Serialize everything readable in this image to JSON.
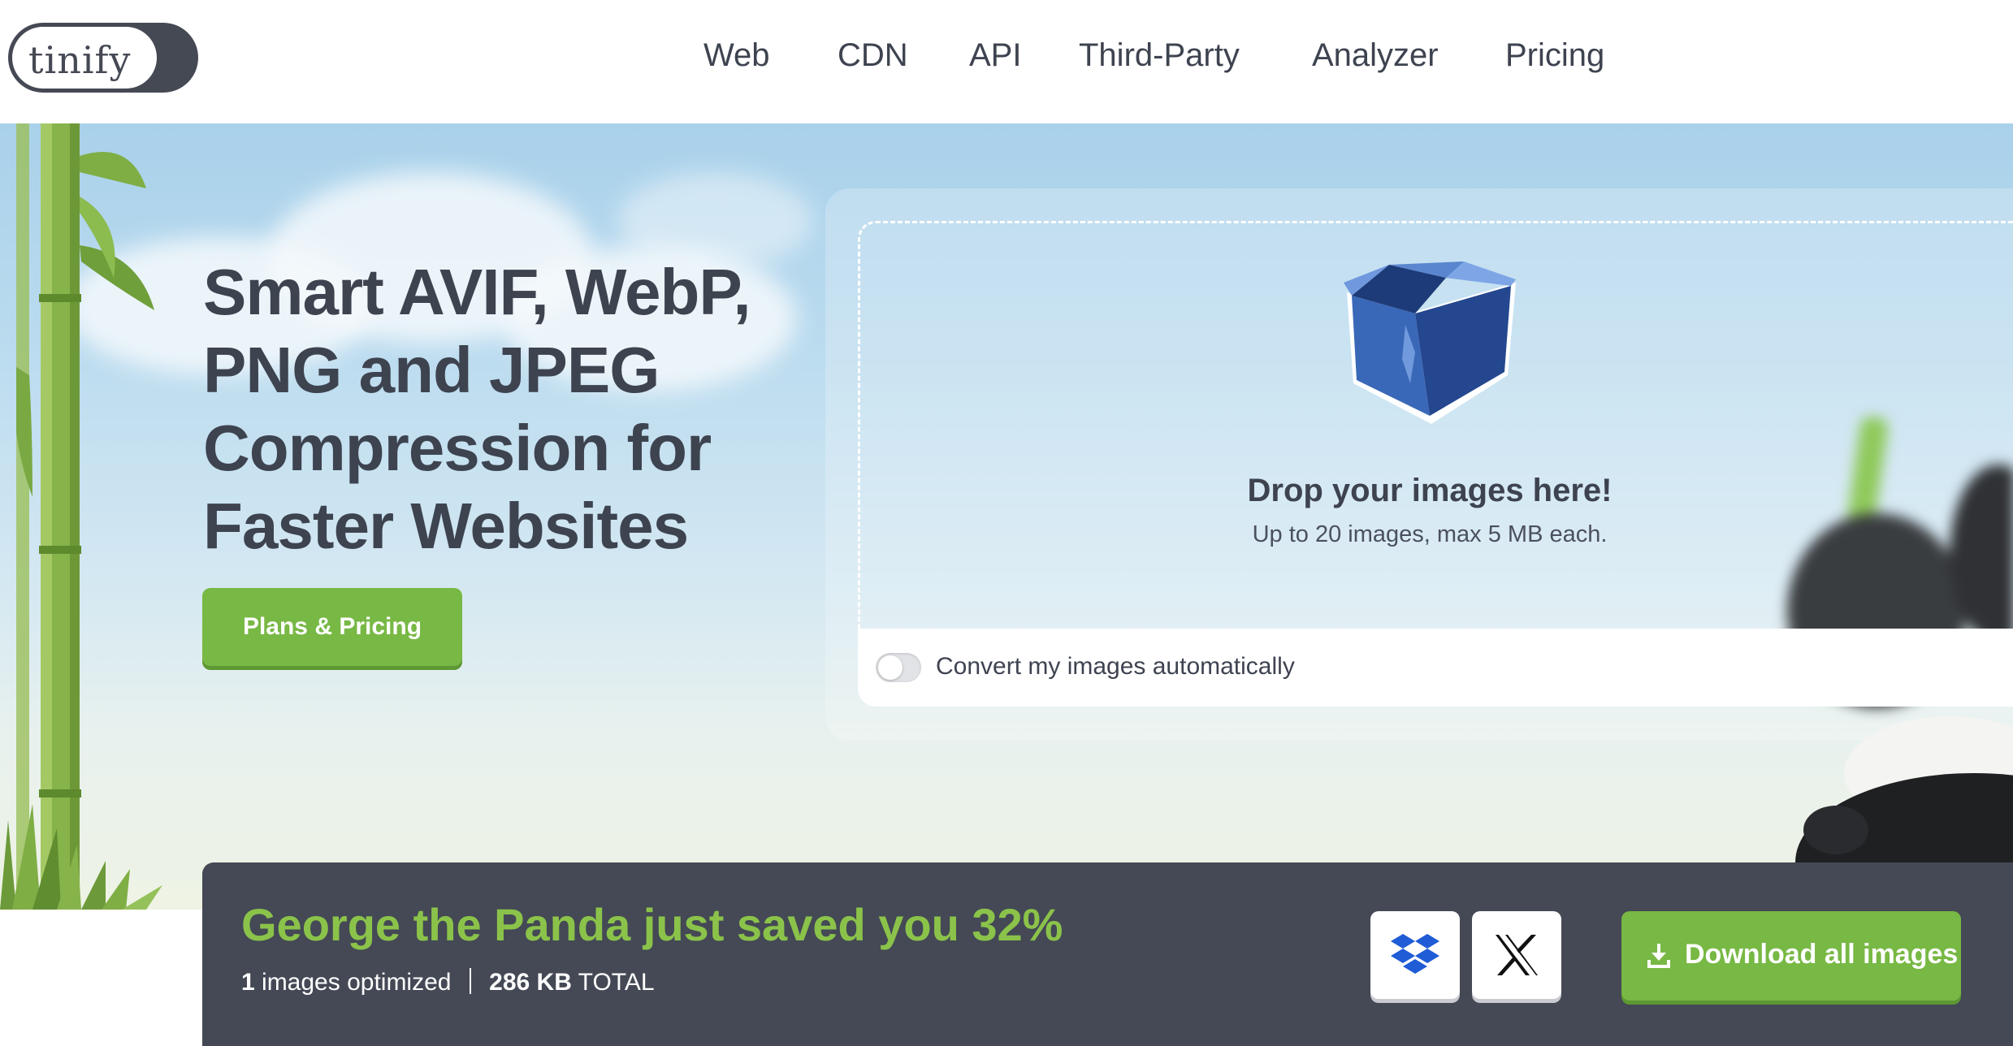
{
  "brand": {
    "logo_text": "tinify"
  },
  "nav": {
    "items": [
      {
        "label": "Web"
      },
      {
        "label": "CDN"
      },
      {
        "label": "API"
      },
      {
        "label": "Third-Party"
      },
      {
        "label": "Analyzer"
      },
      {
        "label": "Pricing"
      }
    ]
  },
  "hero": {
    "headline_lines": [
      "Smart AVIF, WebP,",
      "PNG and JPEG",
      "Compression for",
      "Faster Websites"
    ],
    "cta_label": "Plans & Pricing",
    "cta_color": "#78b844"
  },
  "dropzone": {
    "title": "Drop your images here!",
    "subtitle": "Up to 20 images, max 5 MB each.",
    "icon": "open-box-icon",
    "convert_toggle": {
      "label": "Convert my images automatically",
      "enabled": false
    }
  },
  "result": {
    "title": "George the Panda just saved you 32%",
    "images_count": "1",
    "images_label": "images optimized",
    "total_size": "286 KB",
    "total_label": "TOTAL",
    "share_buttons": [
      {
        "icon": "dropbox-icon"
      },
      {
        "icon": "x-twitter-icon"
      }
    ],
    "download_label": "Download all images",
    "download_icon": "download-icon",
    "bar_color": "#444955",
    "accent_color": "#8bc34a"
  }
}
